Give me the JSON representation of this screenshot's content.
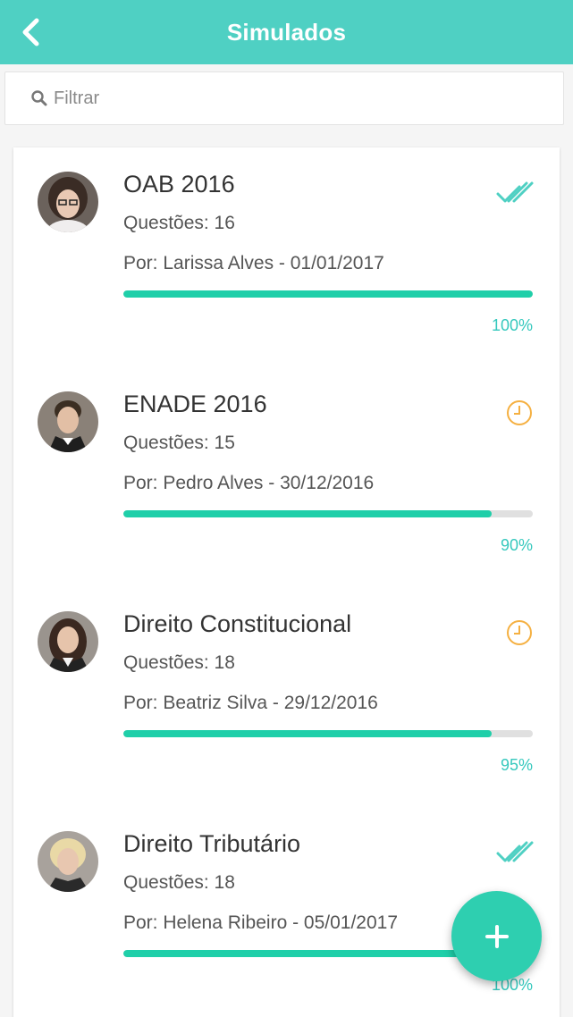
{
  "header": {
    "title": "Simulados",
    "back_icon": "chevron-left-icon"
  },
  "search": {
    "placeholder": "Filtrar",
    "value": ""
  },
  "colors": {
    "header_bg": "#4fd0c3",
    "progress": "#1fcfa9",
    "done": "#4fd0c3",
    "pending": "#f5b041",
    "fab": "#2ecfb0"
  },
  "items": [
    {
      "title": "OAB 2016",
      "questions": "Questões: 16",
      "author": "Por: Larissa Alves - 01/01/2017",
      "progress": 100,
      "progress_label": "100%",
      "status": "done-double-check-icon"
    },
    {
      "title": "ENADE 2016",
      "questions": "Questões: 15",
      "author": "Por: Pedro Alves - 30/12/2016",
      "progress": 90,
      "progress_label": "90%",
      "status": "clock-icon"
    },
    {
      "title": "Direito Constitucional",
      "questions": "Questões: 18",
      "author": "Por: Beatriz Silva - 29/12/2016",
      "progress": 90,
      "progress_label": "95%",
      "status": "clock-icon"
    },
    {
      "title": "Direito Tributário",
      "questions": "Questões: 18",
      "author": "Por: Helena Ribeiro - 05/01/2017",
      "progress": 100,
      "progress_label": "100%",
      "status": "done-double-check-icon"
    }
  ],
  "fab": {
    "icon": "plus-icon"
  }
}
